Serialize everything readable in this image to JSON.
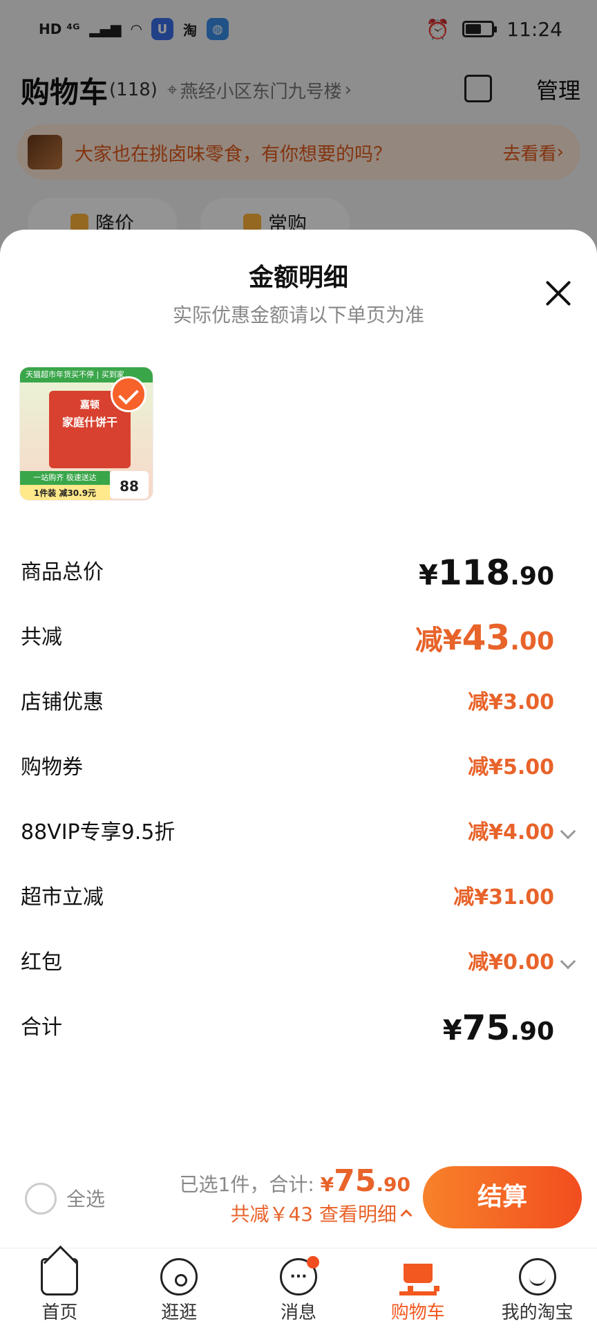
{
  "status_bar": {
    "left_indicators": "HD ⁴ᴳ",
    "app_badge_1": "U",
    "app_badge_2": "淘",
    "time": "11:24"
  },
  "cart_header": {
    "title": "购物车",
    "count": "(118)",
    "address": "燕经小区东门九号楼",
    "manage_label": "管理"
  },
  "banner": {
    "text": "大家也在挑卤味零食，有你想要的吗？",
    "link": "去看看"
  },
  "filters": [
    {
      "label": "降价"
    },
    {
      "label": "常购"
    }
  ],
  "sheet": {
    "title": "金额明细",
    "subtitle": "实际优惠金额请以下单页为准",
    "product": {
      "top_banner": "天猫超市年货买不停 | 买到家",
      "brand": "嘉顿",
      "name": "家庭什饼干",
      "tag": "一站购齐 极速送达",
      "deal": "1件装 减30.9元",
      "price": "88"
    },
    "rows": {
      "subtotal": {
        "label": "商品总价",
        "prefix": "¥",
        "int": "118",
        "dec": ".90"
      },
      "total_discount": {
        "label": "共减",
        "prefix": "减¥",
        "int": "43",
        "dec": ".00"
      },
      "shop": {
        "label": "店铺优惠",
        "value": "减¥3.00"
      },
      "coupon": {
        "label": "购物券",
        "value": "减¥5.00"
      },
      "vip": {
        "label": "88VIP专享9.5折",
        "value": "减¥4.00"
      },
      "market": {
        "label": "超市立减",
        "value": "减¥31.00"
      },
      "redpacket": {
        "label": "红包",
        "value": "减¥0.00"
      },
      "total": {
        "label": "合计",
        "prefix": "¥",
        "int": "75",
        "dec": ".90"
      }
    }
  },
  "checkout": {
    "select_all": "全选",
    "selected_text": "已选1件，合计:",
    "currency": "¥",
    "total_int": "75",
    "total_dec": ".90",
    "discount_text": "共减￥43 查看明细",
    "button": "结算"
  },
  "tabbar": [
    {
      "label": "首页"
    },
    {
      "label": "逛逛"
    },
    {
      "label": "消息"
    },
    {
      "label": "购物车"
    },
    {
      "label": "我的淘宝"
    }
  ],
  "colors": {
    "accent": "#f2581f",
    "discount": "#e8632a"
  }
}
